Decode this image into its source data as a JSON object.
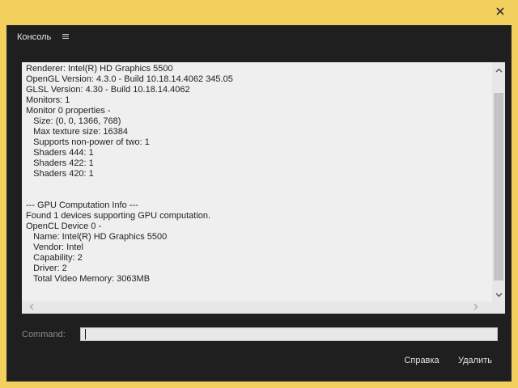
{
  "window": {
    "close_icon": "close-icon"
  },
  "panel": {
    "title": "Консоль",
    "menu_icon": "hamburger-menu-icon"
  },
  "console": {
    "lines": [
      "Renderer: Intel(R) HD Graphics 5500",
      "OpenGL Version: 4.3.0 - Build 10.18.14.4062 345.05",
      "GLSL Version: 4.30 - Build 10.18.14.4062",
      "Monitors: 1",
      "Monitor 0 properties -",
      "   Size: (0, 0, 1366, 768)",
      "   Max texture size: 16384",
      "   Supports non-power of two: 1",
      "   Shaders 444: 1",
      "   Shaders 422: 1",
      "   Shaders 420: 1",
      "",
      "",
      "--- GPU Computation Info ---",
      "Found 1 devices supporting GPU computation.",
      "OpenCL Device 0 -",
      "   Name: Intel(R) HD Graphics 5500",
      "   Vendor: Intel",
      "   Capability: 2",
      "   Driver: 2",
      "   Total Video Memory: 3063MB"
    ]
  },
  "command": {
    "label": "Command:",
    "value": ""
  },
  "buttons": {
    "help": "Справка",
    "delete": "Удалить"
  },
  "colors": {
    "window_frame": "#f3cf5e",
    "panel_bg": "#1f1f1f",
    "output_bg": "#efefef"
  }
}
